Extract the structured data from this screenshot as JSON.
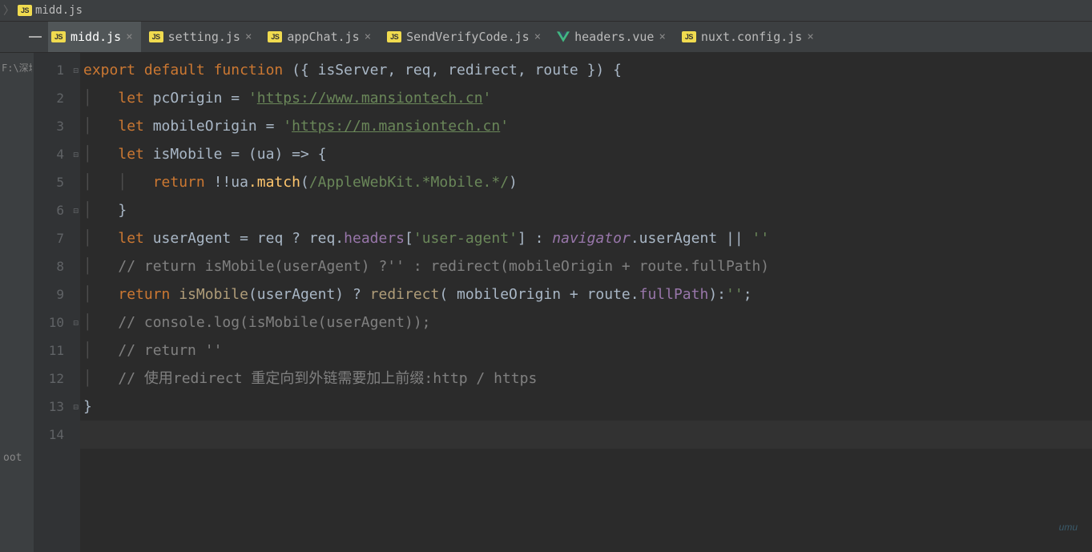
{
  "crumb": {
    "file": "midd.js"
  },
  "tabs": [
    {
      "label": "midd.js",
      "icon": "js",
      "active": true
    },
    {
      "label": "setting.js",
      "icon": "js",
      "active": false
    },
    {
      "label": "appChat.js",
      "icon": "js",
      "active": false
    },
    {
      "label": "SendVerifyCode.js",
      "icon": "js",
      "active": false
    },
    {
      "label": "headers.vue",
      "icon": "vue",
      "active": false
    },
    {
      "label": "nuxt.config.js",
      "icon": "js",
      "active": false
    }
  ],
  "side": {
    "path_fragment": "F:\\深圳",
    "root_label": "oot"
  },
  "code": {
    "line_count": 14,
    "k_export": "export",
    "k_default": "default",
    "k_function": "function",
    "k_let": "let",
    "k_return": "return",
    "sig_args": " ({ isServer, req, redirect, route }) {",
    "pcOrigin_name": "pcOrigin",
    "eq": " = ",
    "q": "'",
    "pcOrigin_url": "https://www.mansiontech.cn",
    "mobileOrigin_name": "mobileOrigin",
    "mobileOrigin_url": "https://m.mansiontech.cn",
    "isMobile_name": "isMobile",
    "isMobile_sig": " = (ua) => {",
    "match_call": ".match",
    "bangbang": " !!ua",
    "regex": "/AppleWebKit.*Mobile.*/",
    "close_brace": "}",
    "userAgent_name": "userAgent",
    "ua_expr_a": " = req ? req.",
    "headers_prop": "headers",
    "ua_expr_b": "[",
    "ua_key": "'user-agent'",
    "ua_expr_c": "] : ",
    "navigator": "navigator",
    "ua_expr_d": ".userAgent || ",
    "empty_str": "''",
    "comment8": "// return isMobile(userAgent) ?'' : redirect(mobileOrigin + route.fullPath)",
    "ret9_a": " isMobile",
    "ret9_b": "(userAgent) ? ",
    "redirect_call": "redirect",
    "ret9_c": "( mobileOrigin + route.",
    "fullPath_prop": "fullPath",
    "ret9_d": "):",
    "ret9_e": ";",
    "comment10": "// console.log(isMobile(userAgent));",
    "comment11": "// return ''",
    "comment12": "// 使用redirect 重定向到外链需要加上前缀:http / https"
  }
}
